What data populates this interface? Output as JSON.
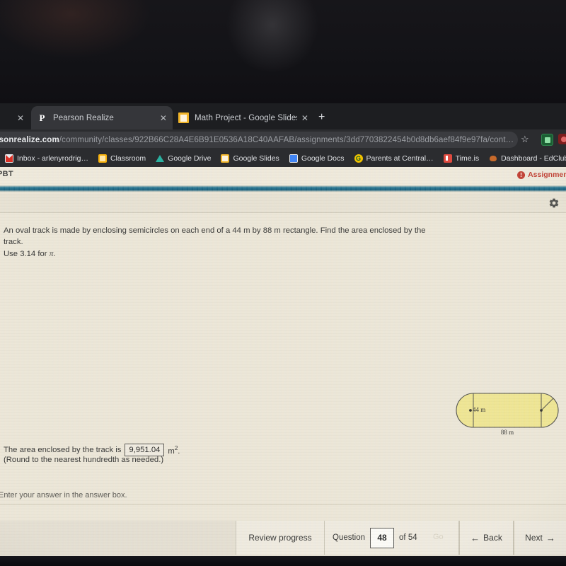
{
  "browser": {
    "tabs": [
      {
        "title": "",
        "favicon": "partial-tab-icon",
        "active": false,
        "partial": true
      },
      {
        "title": "Pearson Realize",
        "favicon": "pearson-icon",
        "active": true,
        "partial": false
      },
      {
        "title": "Math Project - Google Slides",
        "favicon": "google-slides-icon",
        "active": false,
        "partial": false
      }
    ],
    "new_tab_label": "+",
    "close_label": "✕",
    "address": {
      "domain": "rsonrealize.com",
      "path": "/community/classes/922B66C28A4E6B91E0536A18C40AAFAB/assignments/3dd7703822454b0d8db6aef84f9e97fa/cont…"
    },
    "bookmarks": [
      {
        "label": "Inbox - arlenyrodrig…",
        "icon": "gmail-icon"
      },
      {
        "label": "Classroom",
        "icon": "google-classroom-icon"
      },
      {
        "label": "Google Drive",
        "icon": "google-drive-icon"
      },
      {
        "label": "Google Slides",
        "icon": "google-slides-icon"
      },
      {
        "label": "Google Docs",
        "icon": "google-docs-icon"
      },
      {
        "label": "Parents at Central…",
        "icon": "parents-portal-icon"
      },
      {
        "label": "Time.is",
        "icon": "timeis-icon"
      },
      {
        "label": "Dashboard - EdClub",
        "icon": "edclub-icon"
      }
    ]
  },
  "app": {
    "header_left_label": "PBT",
    "assignment_notice": "Assignment i",
    "assignment_notice_icon": "alert-circle-icon",
    "settings_icon": "gear-icon",
    "notice_color": "#c0392b",
    "accent_color": "#1c6e8c"
  },
  "question": {
    "prompt_line1": "An oval track is made by enclosing semicircles on each end of a 44 m by 88 m rectangle. Find the area enclosed by the track.",
    "prompt_line2_pre": "Use 3.14 for ",
    "prompt_line2_symbol": "π",
    "prompt_line2_post": ".",
    "answer_label": "The area enclosed by the track is",
    "answer_value": "9,951.04",
    "answer_unit": "m",
    "answer_unit_exponent": "2",
    "answer_unit_trailing": ".",
    "rounding_note": "(Round to the nearest hundredth as needed.)",
    "enter_note": "Enter your answer in the answer box."
  },
  "figure": {
    "name": "oval-track-diagram",
    "width_label": "44 m",
    "length_label": "88 m",
    "fill_color": "#efe58f",
    "stroke_color": "#4a4a44"
  },
  "nav": {
    "review_label": "Review progress",
    "question_word": "Question",
    "question_number": "48",
    "of_word": "of 54",
    "go_label": "Go",
    "back_label": "Back",
    "back_arrow": "←",
    "next_label": "Next",
    "next_arrow": "→"
  }
}
